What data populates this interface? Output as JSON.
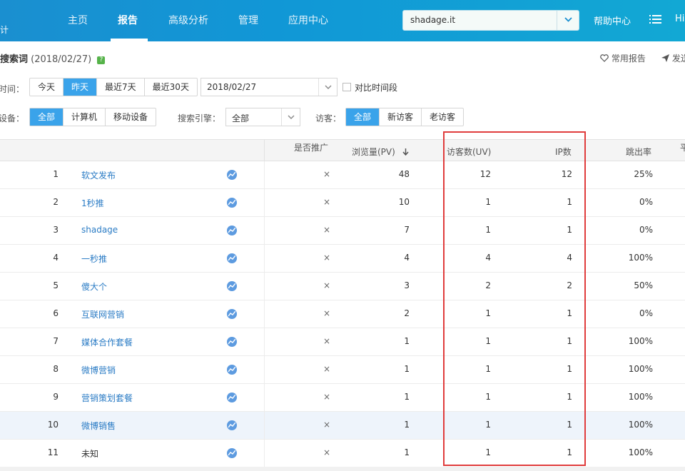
{
  "header": {
    "brand_fragment": "统计",
    "nav": [
      "主页",
      "报告",
      "高级分析",
      "管理",
      "应用中心"
    ],
    "active_nav": "报告",
    "site": "shadage.it",
    "help": "帮助中心",
    "user_fragment": "Hi"
  },
  "title": {
    "name": "搜索词",
    "date": "(2018/02/27)",
    "help_badge": "?",
    "favorite": "常用报告",
    "send": "发送"
  },
  "filters": {
    "time_label": "时间：",
    "time_options": [
      "今天",
      "昨天",
      "最近7天",
      "最近30天"
    ],
    "time_selected": "昨天",
    "date_value": "2018/02/27",
    "compare_label": "对比时间段",
    "device_label": "设备：",
    "device_options": [
      "全部",
      "计算机",
      "移动设备"
    ],
    "device_selected": "全部",
    "engine_label": "搜索引擎：",
    "engine_value": "全部",
    "visitor_label": "访客：",
    "visitor_options": [
      "全部",
      "新访客",
      "老访客"
    ],
    "visitor_selected": "全部"
  },
  "table": {
    "columns": {
      "promoted": "是否推广",
      "pv": "浏览量(PV)",
      "uv": "访客数(UV)",
      "ip": "IP数",
      "bounce": "跳出率",
      "next_fragment": "平"
    },
    "rows": [
      {
        "idx": "1",
        "keyword": "软文发布",
        "promoted": "×",
        "pv": "48",
        "uv": "12",
        "ip": "12",
        "bounce": "25%"
      },
      {
        "idx": "2",
        "keyword": "1秒推",
        "promoted": "×",
        "pv": "10",
        "uv": "1",
        "ip": "1",
        "bounce": "0%"
      },
      {
        "idx": "3",
        "keyword": "shadage",
        "promoted": "×",
        "pv": "7",
        "uv": "1",
        "ip": "1",
        "bounce": "0%"
      },
      {
        "idx": "4",
        "keyword": "一秒推",
        "promoted": "×",
        "pv": "4",
        "uv": "4",
        "ip": "4",
        "bounce": "100%"
      },
      {
        "idx": "5",
        "keyword": "傻大个",
        "promoted": "×",
        "pv": "3",
        "uv": "2",
        "ip": "2",
        "bounce": "50%"
      },
      {
        "idx": "6",
        "keyword": "互联网营销",
        "promoted": "×",
        "pv": "2",
        "uv": "1",
        "ip": "1",
        "bounce": "0%"
      },
      {
        "idx": "7",
        "keyword": "媒体合作套餐",
        "promoted": "×",
        "pv": "1",
        "uv": "1",
        "ip": "1",
        "bounce": "100%"
      },
      {
        "idx": "8",
        "keyword": "微博营销",
        "promoted": "×",
        "pv": "1",
        "uv": "1",
        "ip": "1",
        "bounce": "100%"
      },
      {
        "idx": "9",
        "keyword": "营销策划套餐",
        "promoted": "×",
        "pv": "1",
        "uv": "1",
        "ip": "1",
        "bounce": "100%"
      },
      {
        "idx": "10",
        "keyword": "微博销售",
        "promoted": "×",
        "pv": "1",
        "uv": "1",
        "ip": "1",
        "bounce": "100%"
      },
      {
        "idx": "11",
        "keyword": "未知",
        "promoted": "×",
        "pv": "1",
        "uv": "1",
        "ip": "1",
        "bounce": "100%"
      }
    ]
  },
  "colors": {
    "header": "#1197d6",
    "accent": "#3aa3ea",
    "link": "#2b7cc5",
    "highlight_box": "#e03c3c"
  }
}
